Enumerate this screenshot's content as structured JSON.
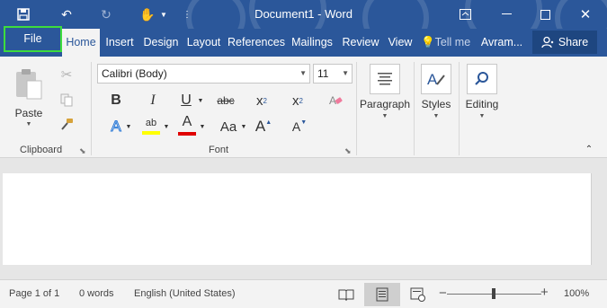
{
  "title_bar": {
    "document_title": "Document1 - Word",
    "quick_access": [
      "save-icon",
      "undo-icon",
      "redo-icon",
      "touch-mode-icon",
      "customize-icon"
    ],
    "window_controls": [
      "ribbon-display-icon",
      "minimize-icon",
      "maximize-icon",
      "close-icon"
    ]
  },
  "tabs": [
    {
      "label": "File",
      "name": "tab-file"
    },
    {
      "label": "Home",
      "name": "tab-home",
      "active": true
    },
    {
      "label": "Insert",
      "name": "tab-insert"
    },
    {
      "label": "Design",
      "name": "tab-design"
    },
    {
      "label": "Layout",
      "name": "tab-layout"
    },
    {
      "label": "References",
      "name": "tab-references"
    },
    {
      "label": "Mailings",
      "name": "tab-mailings"
    },
    {
      "label": "Review",
      "name": "tab-review"
    },
    {
      "label": "View",
      "name": "tab-view"
    }
  ],
  "tell_me": "Tell me",
  "user": "Avram...",
  "share_label": "Share",
  "ribbon": {
    "clipboard": {
      "paste_label": "Paste",
      "group_label": "Clipboard"
    },
    "font": {
      "font_name": "Calibri (Body)",
      "font_size": "11",
      "group_label": "Font",
      "buttons": {
        "bold": "B",
        "italic": "I",
        "underline": "U",
        "strike": "abc",
        "subscript": "x",
        "subscript_sub": "2",
        "superscript": "x",
        "superscript_sup": "2",
        "change_case": "Aa",
        "grow": "A",
        "shrink": "A",
        "text_effects": "A",
        "font_color": "A",
        "highlight": "ab"
      }
    },
    "paragraph_label": "Paragraph",
    "styles_label": "Styles",
    "editing_label": "Editing"
  },
  "status_bar": {
    "page": "Page 1 of 1",
    "words": "0 words",
    "language": "English (United States)",
    "zoom": "100%",
    "zoom_minus": "−",
    "zoom_plus": "+"
  },
  "colors": {
    "accent": "#2b579a",
    "file_highlight": "#3ddc3d",
    "highlight_yellow": "#ffff00",
    "font_red": "#e00000"
  }
}
